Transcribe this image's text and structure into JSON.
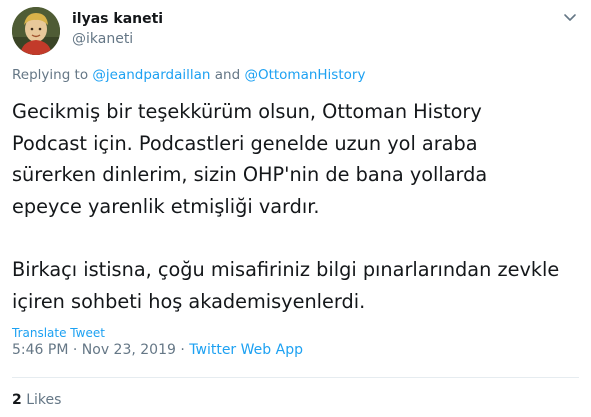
{
  "author": {
    "name": "ilyas kaneti",
    "handle": "@ikaneti"
  },
  "reply": {
    "prefix": "Replying to",
    "user1": "@jeandpardaillan",
    "conjunction": "and",
    "user2": "@OttomanHistory"
  },
  "tweet": {
    "text": "Gecikmiş bir teşekkürüm olsun, Ottoman History\nPodcast için. Podcastleri genelde uzun yol araba\nsürerken dinlerim, sizin OHP'nin de bana yollarda\nepeyce yarenlik etmişliği vardır.\n\nBirkaçı istisna, çoğu misafiriniz bilgi pınarlarından zevkle\niçiren sohbeti hoş akademisyenlerdi.",
    "translate_label": "Translate Tweet",
    "time": "5:46 PM",
    "separator": "·",
    "date": "Nov 23, 2019",
    "app": "Twitter Web App"
  },
  "stats": {
    "likes_count": "2",
    "likes_label": "Likes"
  },
  "icons": {
    "menu": "chevron-down-icon",
    "avatar": "profile-photo"
  },
  "colors": {
    "link": "#1da1f2",
    "secondary_text": "#657786",
    "primary_text": "#14171a",
    "divider": "#e6ecf0"
  }
}
